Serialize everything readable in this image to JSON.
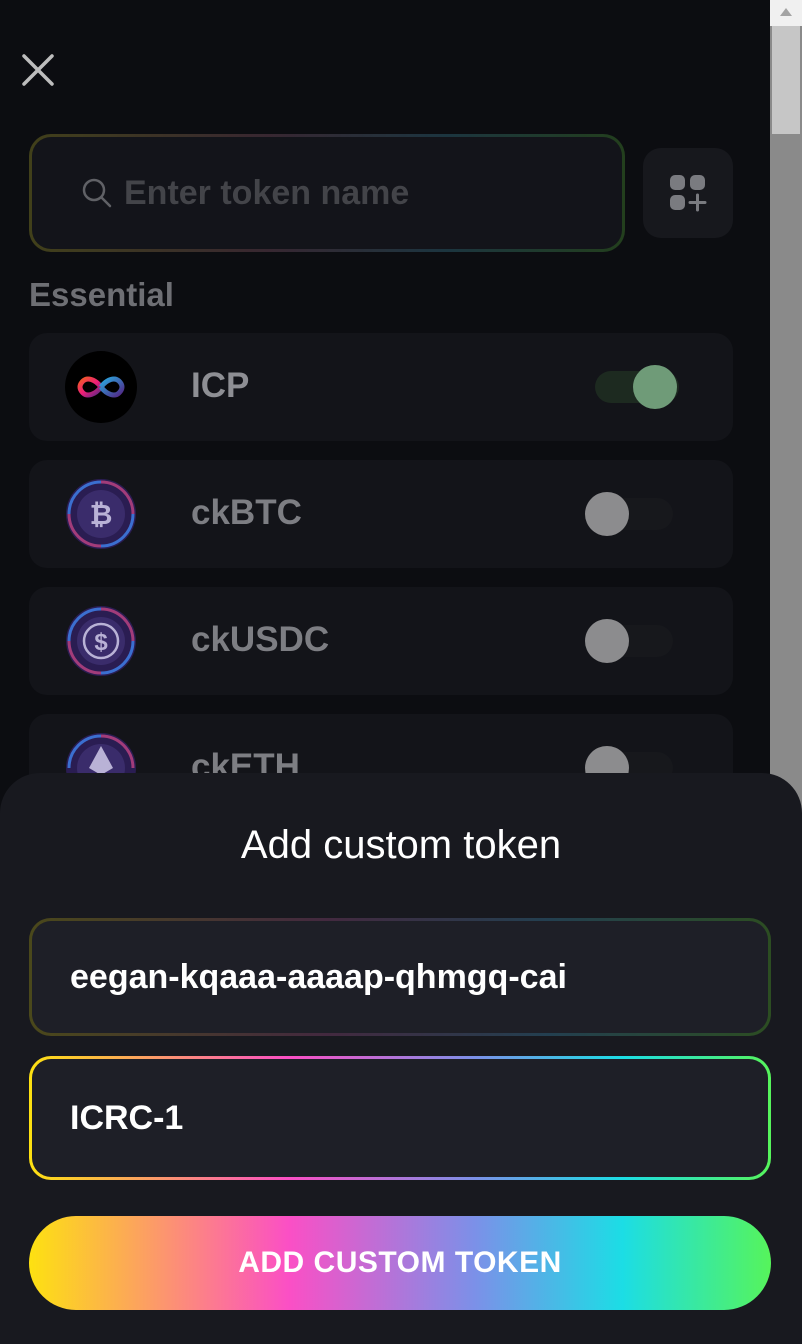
{
  "search": {
    "placeholder": "Enter token name"
  },
  "section": {
    "title": "Essential"
  },
  "tokens": [
    {
      "name": "ICP",
      "enabled": true,
      "icon": "infinity-icon"
    },
    {
      "name": "ckBTC",
      "enabled": false,
      "icon": "bitcoin-icon"
    },
    {
      "name": "ckUSDC",
      "enabled": false,
      "icon": "dollar-icon"
    },
    {
      "name": "ckETH",
      "enabled": false,
      "icon": "ethereum-icon"
    }
  ],
  "sheet": {
    "title": "Add custom token",
    "canister_id": "eegan-kqaaa-aaaap-qhmgq-cai",
    "standard": "ICRC-1",
    "submit_label": "ADD CUSTOM TOKEN"
  },
  "colors": {
    "gradient": [
      "#fde111",
      "#fb4fc5",
      "#7c90e8",
      "#1cdde5",
      "#56f45b"
    ],
    "toggle_on": "#6f9b78"
  }
}
